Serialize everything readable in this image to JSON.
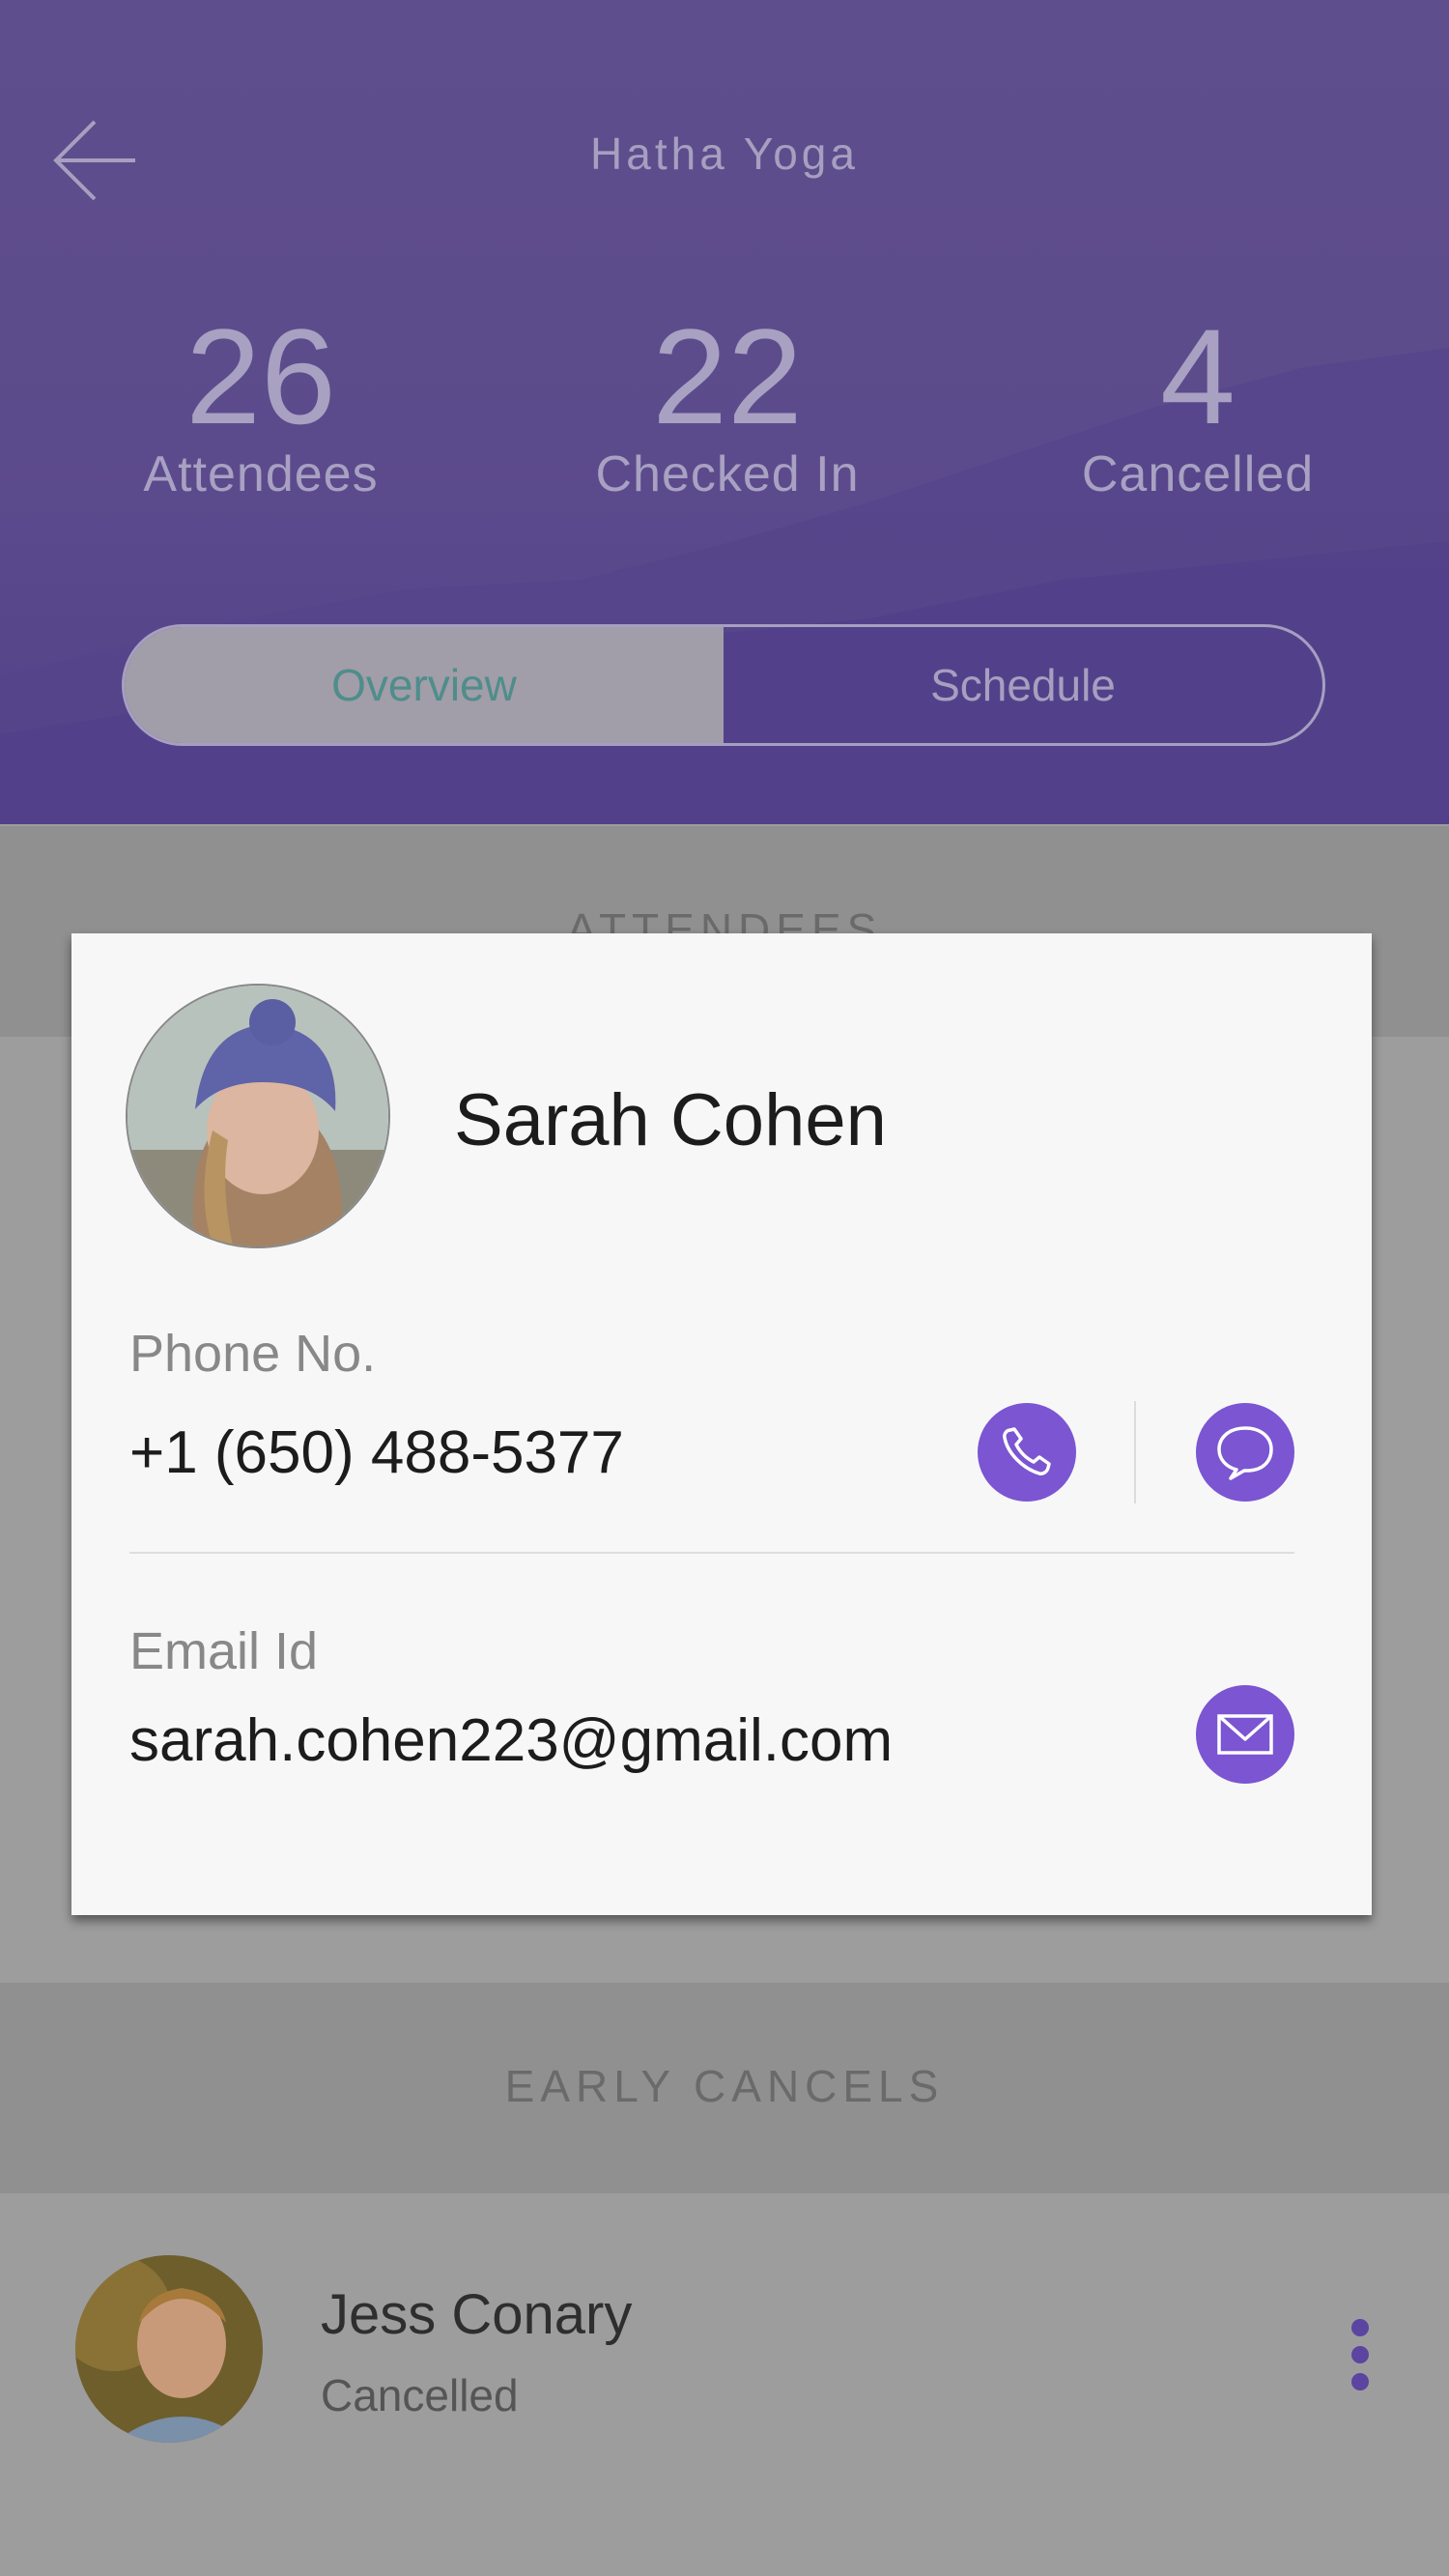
{
  "header": {
    "title": "Hatha Yoga",
    "stats": [
      {
        "value": "26",
        "label": "Attendees"
      },
      {
        "value": "22",
        "label": "Checked In"
      },
      {
        "value": "4",
        "label": "Cancelled"
      }
    ],
    "tabs": [
      {
        "label": "Overview",
        "active": true
      },
      {
        "label": "Schedule",
        "active": false
      }
    ]
  },
  "sections": {
    "attendees": "ATTENDEES",
    "early_cancels": "EARLY CANCELS"
  },
  "cancel_list": [
    {
      "name": "Jess Conary",
      "status": "Cancelled"
    }
  ],
  "contact_card": {
    "name": "Sarah Cohen",
    "phone_label": "Phone No.",
    "phone": "+1 (650) 488-5377",
    "email_label": "Email Id",
    "email": "sarah.cohen223@gmail.com"
  },
  "colors": {
    "header_bg": "#5d4c8c",
    "accent": "#7b55d2",
    "active_tab_text": "#4f8d8b"
  },
  "icons": [
    "back-arrow-icon",
    "phone-icon",
    "chat-icon",
    "mail-icon",
    "more-vertical-icon"
  ]
}
